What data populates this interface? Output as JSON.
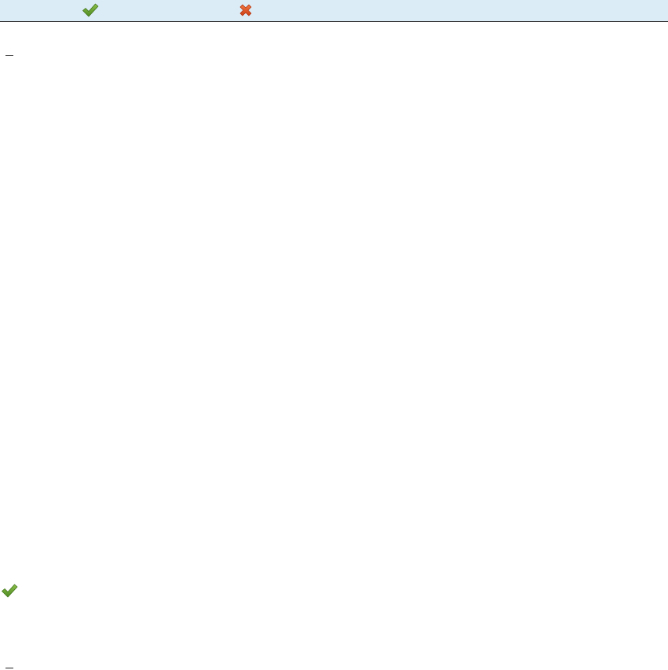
{
  "header": {
    "accept_icon": "checkmark-icon",
    "reject_icon": "cross-icon"
  },
  "footer": {
    "accept_icon": "checkmark-icon"
  },
  "colors": {
    "header_background": "#dcecf7",
    "accept_green": "#5f9b2e",
    "reject_orange": "#e0582a"
  }
}
